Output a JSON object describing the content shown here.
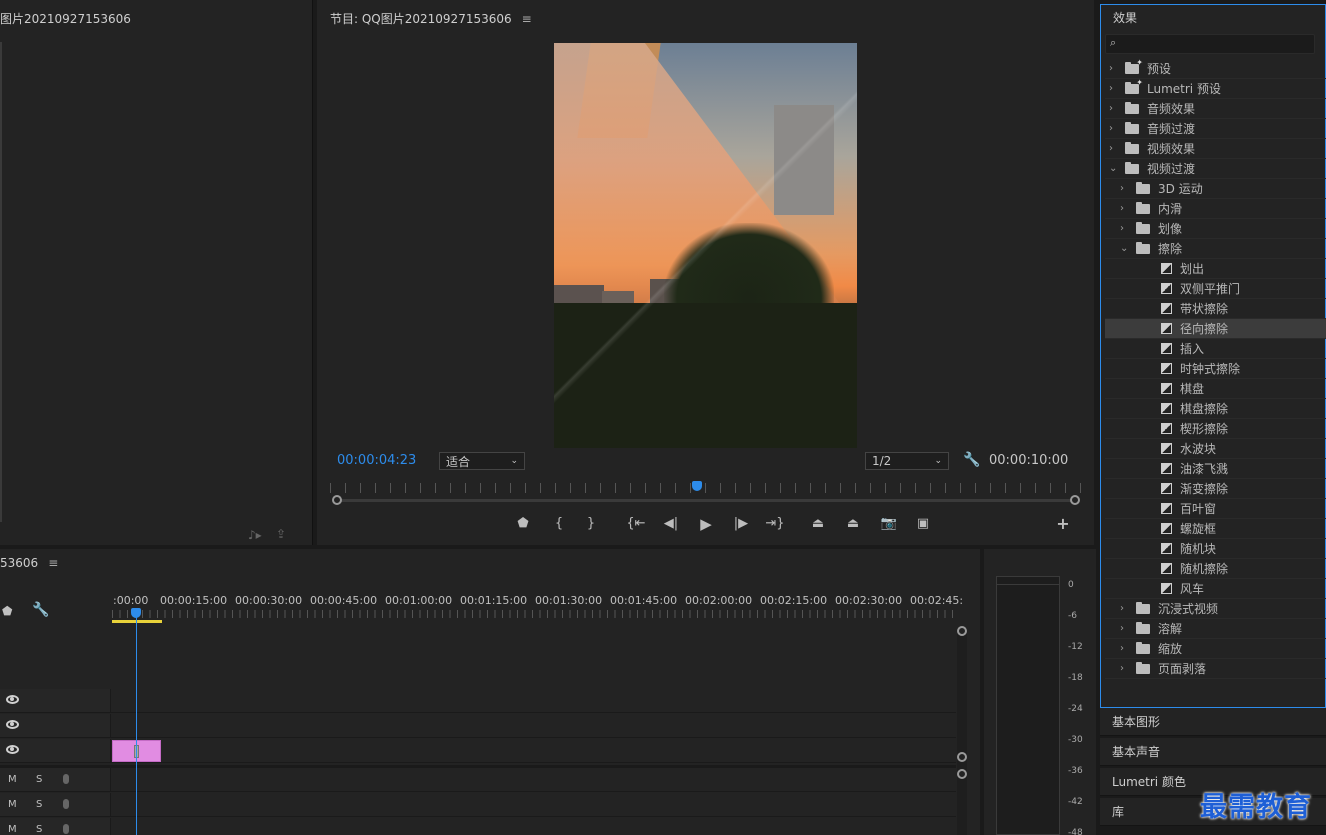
{
  "source": {
    "title": "图片20210927153606"
  },
  "program": {
    "title": "节目: QQ图片20210927153606",
    "menu_glyph": "≡",
    "current_time": "00:00:04:23",
    "duration": "00:00:10:00",
    "fit_label": "适合",
    "resolution_label": "1/2",
    "playhead_position_fraction": 0.488
  },
  "effects": {
    "title": "效果",
    "items": [
      {
        "label": "预设",
        "level": 0,
        "kind": "preset-folder"
      },
      {
        "label": "Lumetri 预设",
        "level": 0,
        "kind": "preset-folder"
      },
      {
        "label": "音频效果",
        "level": 0,
        "kind": "folder"
      },
      {
        "label": "音频过渡",
        "level": 0,
        "kind": "folder"
      },
      {
        "label": "视频效果",
        "level": 0,
        "kind": "folder"
      },
      {
        "label": "视频过渡",
        "level": 0,
        "kind": "folder",
        "expanded": true
      },
      {
        "label": "3D 运动",
        "level": 1,
        "kind": "folder"
      },
      {
        "label": "内滑",
        "level": 1,
        "kind": "folder"
      },
      {
        "label": "划像",
        "level": 1,
        "kind": "folder"
      },
      {
        "label": "擦除",
        "level": 1,
        "kind": "folder",
        "expanded": true
      },
      {
        "label": "划出",
        "level": 2,
        "kind": "transition"
      },
      {
        "label": "双侧平推门",
        "level": 2,
        "kind": "transition"
      },
      {
        "label": "带状擦除",
        "level": 2,
        "kind": "transition"
      },
      {
        "label": "径向擦除",
        "level": 2,
        "kind": "transition",
        "selected": true
      },
      {
        "label": "插入",
        "level": 2,
        "kind": "transition"
      },
      {
        "label": "时钟式擦除",
        "level": 2,
        "kind": "transition"
      },
      {
        "label": "棋盘",
        "level": 2,
        "kind": "transition"
      },
      {
        "label": "棋盘擦除",
        "level": 2,
        "kind": "transition"
      },
      {
        "label": "楔形擦除",
        "level": 2,
        "kind": "transition"
      },
      {
        "label": "水波块",
        "level": 2,
        "kind": "transition"
      },
      {
        "label": "油漆飞溅",
        "level": 2,
        "kind": "transition"
      },
      {
        "label": "渐变擦除",
        "level": 2,
        "kind": "transition"
      },
      {
        "label": "百叶窗",
        "level": 2,
        "kind": "transition"
      },
      {
        "label": "螺旋框",
        "level": 2,
        "kind": "transition"
      },
      {
        "label": "随机块",
        "level": 2,
        "kind": "transition"
      },
      {
        "label": "随机擦除",
        "level": 2,
        "kind": "transition"
      },
      {
        "label": "风车",
        "level": 2,
        "kind": "transition"
      },
      {
        "label": "沉浸式视频",
        "level": 1,
        "kind": "folder"
      },
      {
        "label": "溶解",
        "level": 1,
        "kind": "folder"
      },
      {
        "label": "缩放",
        "level": 1,
        "kind": "folder"
      },
      {
        "label": "页面剥落",
        "level": 1,
        "kind": "folder"
      }
    ]
  },
  "collapsed_panels": [
    "基本图形",
    "基本声音",
    "Lumetri 颜色",
    "库"
  ],
  "timeline": {
    "title": "53606",
    "menu_glyph": "≡",
    "ruler_labels": [
      ":00:00",
      "00:00:15:00",
      "00:00:30:00",
      "00:00:45:00",
      "00:01:00:00",
      "00:01:15:00",
      "00:01:30:00",
      "00:01:45:00",
      "00:02:00:00",
      "00:02:15:00",
      "00:02:30:00",
      "00:02:45:"
    ],
    "mute_label": "M",
    "solo_label": "S"
  },
  "meter": {
    "scale": [
      "0",
      "-6",
      "-12",
      "-18",
      "-24",
      "-30",
      "-36",
      "-42",
      "-48"
    ]
  },
  "watermark": "最需教育",
  "colors": {
    "accent_blue": "#2d8ceb",
    "clip_pink": "#e18ce2",
    "panel_bg": "#232323"
  }
}
